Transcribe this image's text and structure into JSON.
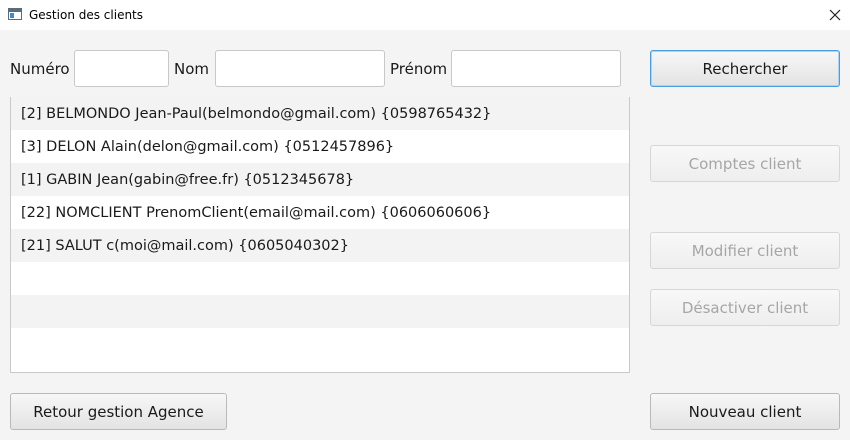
{
  "window": {
    "title": "Gestion des clients"
  },
  "search": {
    "numero_label": "Numéro",
    "numero_value": "",
    "nom_label": "Nom",
    "nom_value": "",
    "prenom_label": "Prénom",
    "prenom_value": ""
  },
  "buttons": {
    "search": "Rechercher",
    "accounts": "Comptes client",
    "modify": "Modifier client",
    "deactivate": "Désactiver client",
    "back": "Retour gestion Agence",
    "new": "Nouveau client"
  },
  "clients": [
    "[2]  BELMONDO Jean-Paul(belmondo@gmail.com)  {0598765432}",
    "[3]  DELON Alain(delon@gmail.com)  {0512457896}",
    "[1]  GABIN Jean(gabin@free.fr)  {0512345678}",
    "[22]  NOMCLIENT PrenomClient(email@mail.com)  {0606060606}",
    "[21]  SALUT c(moi@mail.com)  {0605040302}",
    "",
    "",
    ""
  ],
  "colors": {
    "accent_border": "#4a9ee0",
    "disabled_text": "#a6a6a6"
  }
}
